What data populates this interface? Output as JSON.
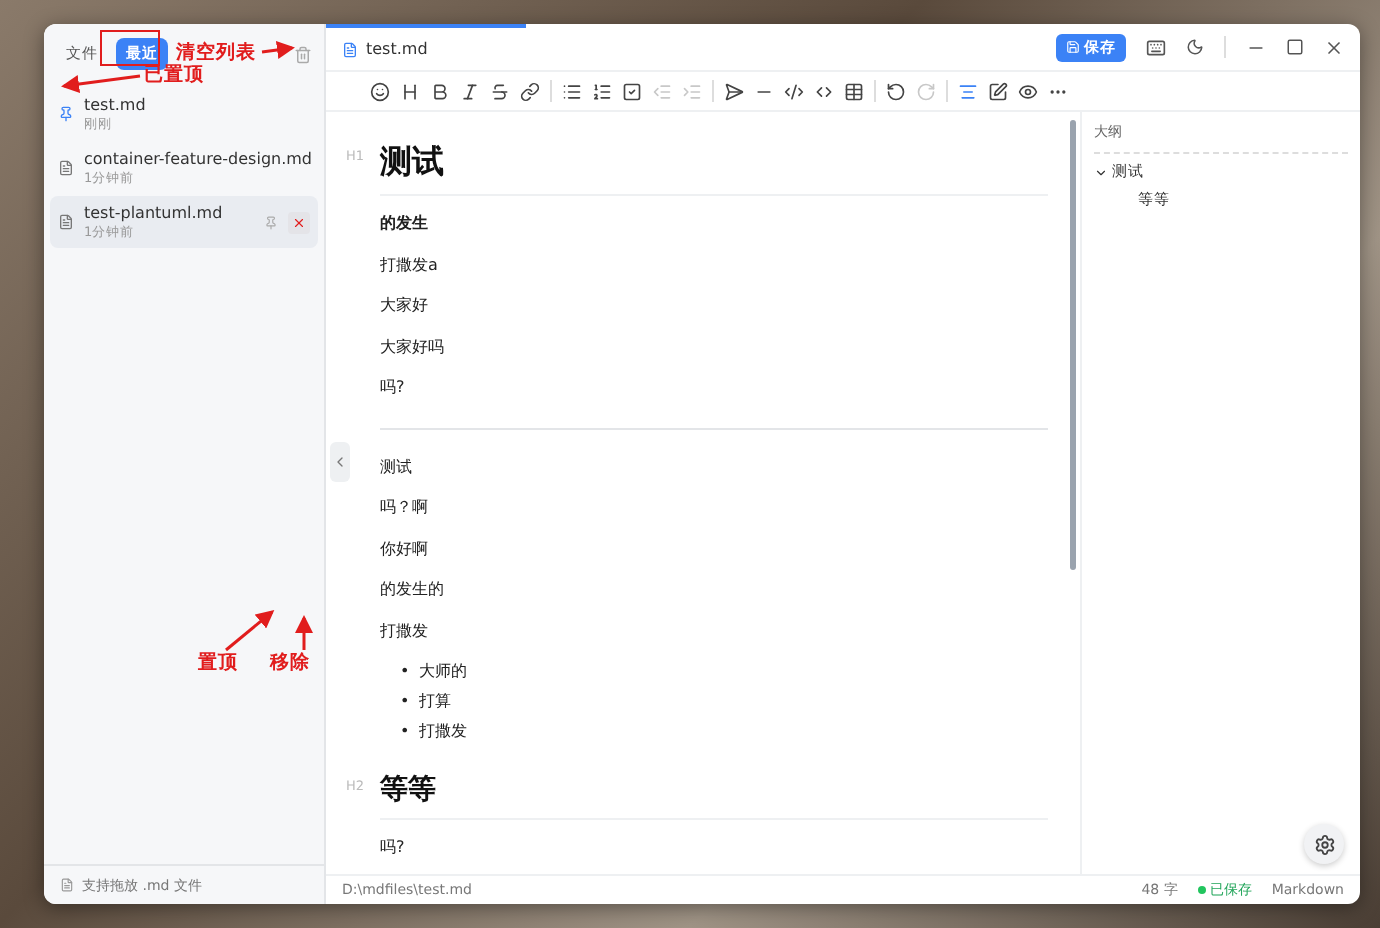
{
  "sidebar": {
    "tabs": [
      {
        "label": "文件",
        "selected": false
      },
      {
        "label": "最近",
        "selected": true
      }
    ],
    "files": [
      {
        "name": "test.md",
        "time": "刚刚",
        "pinned": true,
        "selected": false
      },
      {
        "name": "container-feature-design.md",
        "time": "1分钟前",
        "pinned": false,
        "selected": false
      },
      {
        "name": "test-plantuml.md",
        "time": "1分钟前",
        "pinned": false,
        "selected": true
      }
    ],
    "footer": "支持拖放 .md 文件"
  },
  "editor": {
    "tab": {
      "label": "test.md",
      "selected": true
    },
    "save_button": "保存",
    "tool_groups": [
      [
        {
          "kind": "emoji",
          "disabled": false,
          "active": false
        },
        {
          "kind": "heading",
          "disabled": false,
          "active": false
        },
        {
          "kind": "bold",
          "disabled": false,
          "active": false
        },
        {
          "kind": "italic",
          "disabled": false,
          "active": false
        },
        {
          "kind": "strike",
          "disabled": false,
          "active": false
        },
        {
          "kind": "link",
          "disabled": false,
          "active": false
        }
      ],
      [
        {
          "kind": "ul",
          "disabled": false,
          "active": false
        },
        {
          "kind": "ol",
          "disabled": false,
          "active": false
        },
        {
          "kind": "task",
          "disabled": false,
          "active": false
        },
        {
          "kind": "outdent",
          "disabled": true,
          "active": false
        },
        {
          "kind": "indent",
          "disabled": true,
          "active": false
        }
      ],
      [
        {
          "kind": "send",
          "disabled": false,
          "active": false
        },
        {
          "kind": "rule",
          "disabled": false,
          "active": false
        },
        {
          "kind": "code",
          "disabled": false,
          "active": false
        },
        {
          "kind": "inline",
          "disabled": false,
          "active": false
        },
        {
          "kind": "table",
          "disabled": false,
          "active": false
        }
      ],
      [
        {
          "kind": "undo",
          "disabled": false,
          "active": false
        },
        {
          "kind": "redo",
          "disabled": true,
          "active": false
        }
      ],
      [
        {
          "kind": "toc",
          "disabled": false,
          "active": true
        },
        {
          "kind": "edit",
          "disabled": false,
          "active": false
        },
        {
          "kind": "preview",
          "disabled": false,
          "active": false
        },
        {
          "kind": "more",
          "disabled": false,
          "active": false
        }
      ]
    ],
    "blocks": [
      {
        "kind": "heading",
        "tag": "H1",
        "text": "测试"
      },
      {
        "kind": "paragraph",
        "text": "的发生",
        "bold": true
      },
      {
        "kind": "paragraph",
        "text": "打撒发a",
        "bold": false
      },
      {
        "kind": "paragraph",
        "text": "大家好",
        "bold": false
      },
      {
        "kind": "paragraph",
        "text": "大家好吗",
        "bold": false
      },
      {
        "kind": "paragraph",
        "text": "吗?",
        "bold": false
      },
      {
        "kind": "rule"
      },
      {
        "kind": "paragraph",
        "text": "测试",
        "bold": false
      },
      {
        "kind": "paragraph",
        "text": "吗？啊",
        "bold": false
      },
      {
        "kind": "paragraph",
        "text": "你好啊",
        "bold": false
      },
      {
        "kind": "paragraph",
        "text": "的发生的",
        "bold": false
      },
      {
        "kind": "paragraph",
        "text": "打撒发",
        "bold": false
      },
      {
        "kind": "list",
        "marker": "•",
        "items": [
          "大师的",
          "打算",
          "打撒发"
        ]
      },
      {
        "kind": "heading",
        "tag": "H2",
        "text": "等等"
      },
      {
        "kind": "paragraph",
        "text": "吗?",
        "bold": false
      }
    ]
  },
  "outline": {
    "title": "大纲",
    "items": [
      {
        "label": "测试",
        "expanded": true,
        "children": [
          {
            "label": "等等"
          }
        ]
      }
    ]
  },
  "status_bar": {
    "path": "D:\\mdfiles\\test.md",
    "count": "48 字",
    "saved": "已保存",
    "mode": "Markdown"
  },
  "annotations": [
    {
      "text": "清空列表"
    },
    {
      "text": "已置顶"
    },
    {
      "text": "置顶"
    },
    {
      "text": "移除"
    }
  ]
}
